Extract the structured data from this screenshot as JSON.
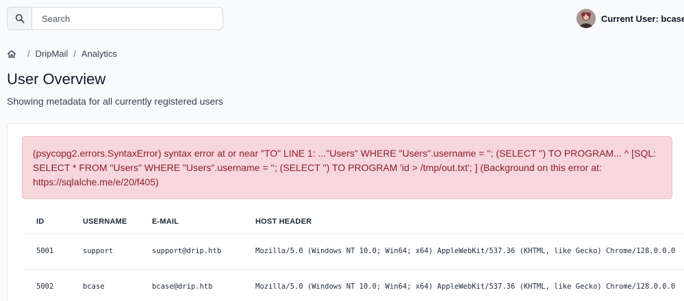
{
  "search": {
    "placeholder": "Search"
  },
  "user": {
    "label": "Current User: bcase"
  },
  "breadcrumb": {
    "items": [
      "DripMail",
      "Analytics"
    ]
  },
  "page": {
    "title": "User Overview",
    "subtitle": "Showing metadata for all currently registered users"
  },
  "alert": {
    "message": "(psycopg2.errors.SyntaxError) syntax error at or near \"TO\" LINE 1: ...\"Users\" WHERE \"Users\".username = ''; (SELECT '') TO PROGRAM... ^ [SQL: SELECT * FROM \"Users\" WHERE \"Users\".username = ''; (SELECT '') TO PROGRAM 'id > /tmp/out.txt'; ] (Background on this error at: https://sqlalche.me/e/20/f405)"
  },
  "table": {
    "headers": [
      "ID",
      "USERNAME",
      "E-MAIL",
      "HOST HEADER"
    ],
    "rows": [
      [
        "5001",
        "support",
        "support@drip.htb",
        "Mozilla/5.0 (Windows NT 10.0; Win64; x64) AppleWebKit/537.36 (KHTML, like Gecko) Chrome/128.0.0.0"
      ],
      [
        "5002",
        "bcase",
        "bcase@drip.htb",
        "Mozilla/5.0 (Windows NT 10.0; Win64; x64) AppleWebKit/537.36 (KHTML, like Gecko) Chrome/128.0.0.0"
      ]
    ]
  },
  "colors": {
    "alert_bg": "#f8d7dc",
    "alert_text": "#8a1c2b",
    "page_bg": "#f9fafb"
  },
  "icons": [
    "search-icon",
    "home-icon",
    "avatar"
  ]
}
